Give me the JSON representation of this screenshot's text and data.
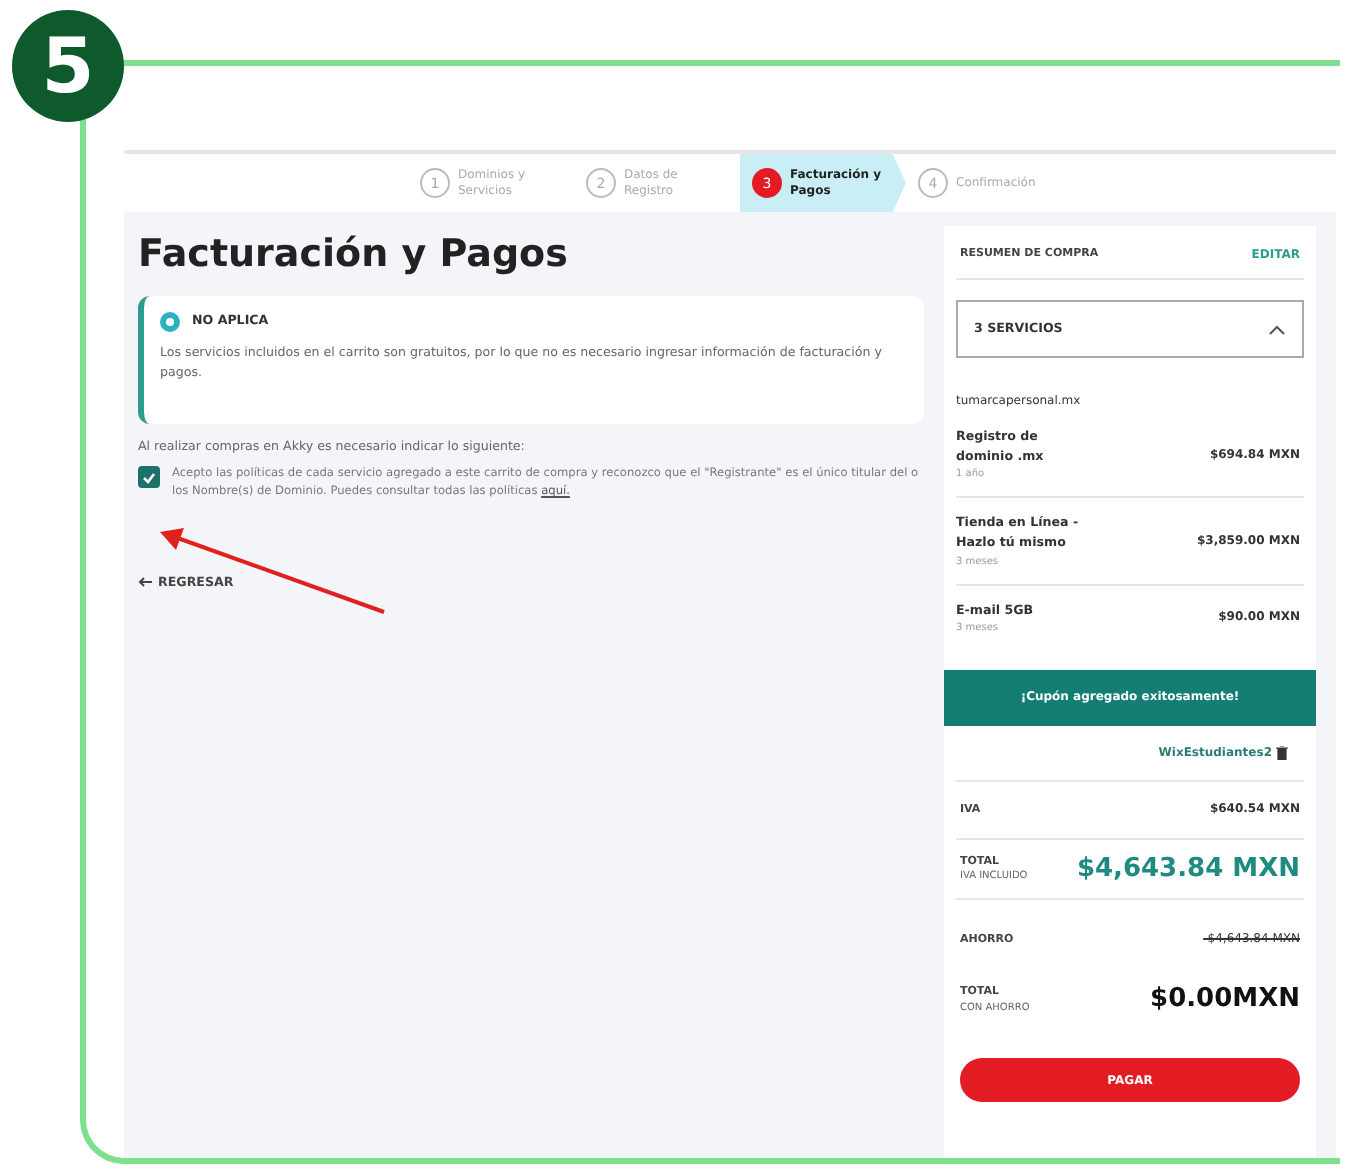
{
  "step_badge": "5",
  "stepper": [
    {
      "number": "1",
      "label": "Dominios y Servicios",
      "selected": false
    },
    {
      "number": "2",
      "label": "Datos de Registro",
      "selected": false
    },
    {
      "number": "3",
      "label": "Facturación y Pagos",
      "selected": true
    },
    {
      "number": "4",
      "label": "Confirmación",
      "selected": false
    }
  ],
  "page": {
    "title": "Facturación y Pagos",
    "notice": {
      "title": "NO APLICA",
      "text": "Los servicios incluidos en el carrito son gratuitos, por lo que no es necesario ingresar información de facturación y pagos."
    },
    "intro": "Al realizar compras en Akky es necesario indicar lo siguiente:",
    "terms": {
      "checked": true,
      "text": "Acepto las políticas de cada servicio agregado a este carrito de compra y reconozco que el \"Registrante\" es el único titular del o los Nombre(s) de Dominio. Puedes consultar todas las políticas ",
      "link": "aquí."
    },
    "back": "REGRESAR"
  },
  "summary": {
    "title": "RESUMEN DE COMPRA",
    "edit": "EDITAR",
    "services": {
      "label": "3 SERVICIOS",
      "expanded": true
    },
    "domain": "tumarcapersonal.mx",
    "items": [
      {
        "name": "Registro de dominio .mx",
        "period": "1 año",
        "price": "$694.84 MXN"
      },
      {
        "name": "Tienda en Línea - Hazlo tú mismo",
        "period": "3 meses",
        "price": "$3,859.00 MXN"
      },
      {
        "name": "E-mail 5GB",
        "period": "3 meses",
        "price": "$90.00 MXN"
      }
    ],
    "coupon_banner": "¡Cupón agregado exitosamente!",
    "coupon_code": "WixEstudiantes2",
    "iva": {
      "label": "IVA",
      "value": "$640.54 MXN"
    },
    "total": {
      "label": "TOTAL",
      "sublabel": "IVA INCLUIDO",
      "value": "$4,643.84 MXN"
    },
    "savings": {
      "label": "AHORRO",
      "value": "-$4,643.84 MXN"
    },
    "final": {
      "label": "TOTAL",
      "sublabel": "CON AHORRO",
      "value": "$0.00MXN"
    },
    "pay": "PAGAR"
  }
}
